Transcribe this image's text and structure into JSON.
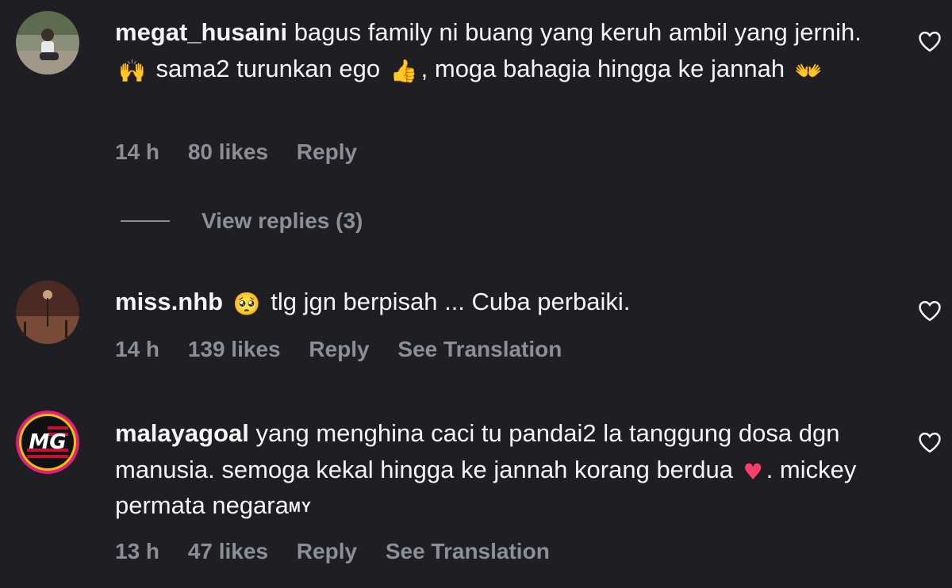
{
  "comments": [
    {
      "username": "megat_husaini",
      "text_parts": [
        "bagus family ni buang yang keruh ambil yang jernih.",
        "sama2 turunkan ego",
        ", moga bahagia hingga ke jannah"
      ],
      "emojis": [
        "raised-hands",
        "thumbs-up",
        "open-hands"
      ],
      "time": "14 h",
      "likes": "80 likes",
      "reply_label": "Reply",
      "view_replies": "View replies (3)"
    },
    {
      "username": "miss.nhb",
      "text_parts": [
        "tlg jgn berpisah ... Cuba perbaiki."
      ],
      "emojis": [
        "pleading-face"
      ],
      "time": "14 h",
      "likes": "139 likes",
      "reply_label": "Reply",
      "translate_label": "See Translation"
    },
    {
      "username": "malayagoal",
      "text_parts": [
        "yang menghina caci tu pandai2 la tanggung dosa dgn manusia. semoga kekal hingga ke jannah korang berdua",
        ". mickey permata negara",
        "MY"
      ],
      "emojis": [
        "red-heart"
      ],
      "time": "13 h",
      "likes": "47 likes",
      "reply_label": "Reply",
      "translate_label": "See Translation",
      "avatar_text": "MG"
    }
  ],
  "colors": {
    "background": "#1e1e23",
    "text": "#f5f5f5",
    "secondary": "#8e8e96"
  }
}
